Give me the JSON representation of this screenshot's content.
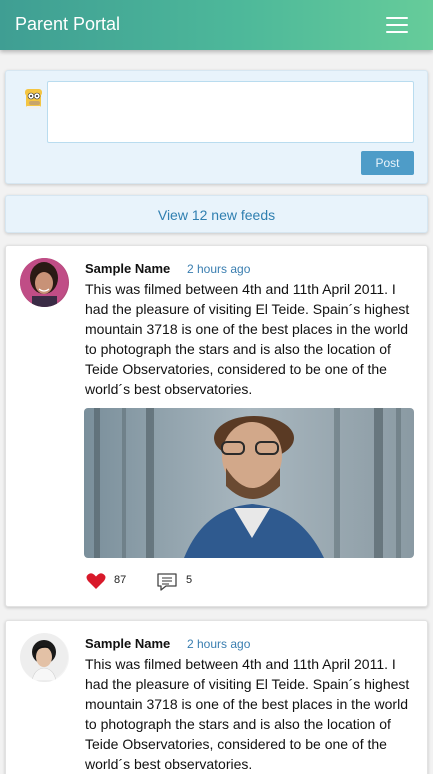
{
  "header": {
    "title": "Parent Portal",
    "menu_icon": "hamburger-menu-icon"
  },
  "composer": {
    "avatar_icon": "cartoon-avatar-icon",
    "text_value": "",
    "post_label": "Post"
  },
  "new_feeds": {
    "label": "View 12 new feeds"
  },
  "posts": [
    {
      "author": "Sample Name",
      "time": "2 hours ago",
      "text": "This was filmed between 4th and 11th April 2011. I had the pleasure of visiting El Teide. Spain´s highest mountain 3718 is one of the best places in the world to photograph the stars and is also the location of Teide Observatories, considered to be one of the world´s best observatories.",
      "likes": "87",
      "comments": "5"
    },
    {
      "author": "Sample Name",
      "time": "2 hours ago",
      "text": "This was filmed between 4th and 11th April 2011. I had the pleasure of visiting El Teide. Spain´s highest mountain 3718 is one of the best places in the world to photograph the stars and is also the location of Teide Observatories, considered to be one of the world´s best observatories."
    }
  ],
  "colors": {
    "header_gradient_start": "#3f9e93",
    "header_gradient_end": "#66cc9a",
    "link_blue": "#2f7fb0",
    "like_red": "#d8192a"
  }
}
